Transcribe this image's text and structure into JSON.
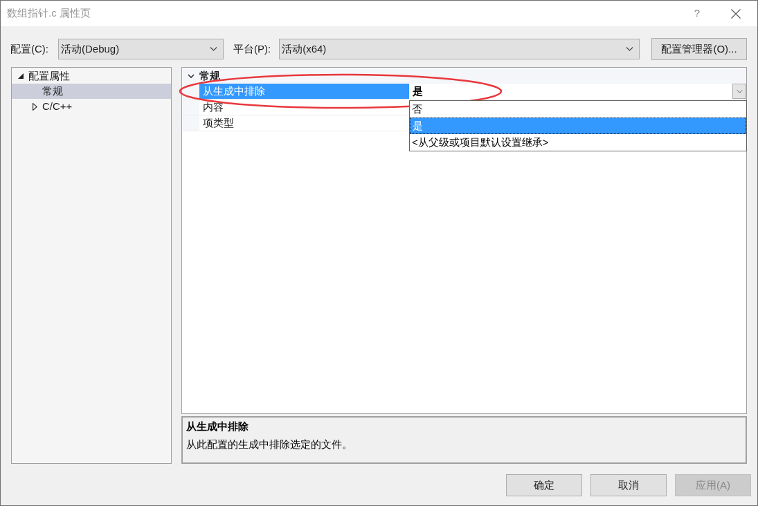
{
  "window": {
    "title": "数组指针.c 属性页",
    "help": "?"
  },
  "toolbar": {
    "configuration": {
      "label": "配置(C):",
      "value": "活动(Debug)"
    },
    "platform": {
      "label": "平台(P):",
      "value": "活动(x64)"
    },
    "manager_button": "配置管理器(O)..."
  },
  "tree": [
    {
      "label": "配置属性",
      "kind": "group",
      "expanded": true,
      "selected": false,
      "children": [
        {
          "label": "常规",
          "kind": "page",
          "selected": true
        },
        {
          "label": "C/C++",
          "kind": "group",
          "expanded": false,
          "selected": false
        }
      ]
    }
  ],
  "property_grid": {
    "categories": [
      {
        "label": "常规",
        "expanded": true,
        "properties": [
          {
            "name": "从生成中排除",
            "value": "是",
            "modified": true,
            "selected": true,
            "dropdown": {
              "open": true,
              "options": [
                {
                  "label": "否",
                  "selected": false
                },
                {
                  "label": "是",
                  "selected": true
                },
                {
                  "label": "<从父级或项目默认设置继承>",
                  "selected": false
                }
              ]
            }
          },
          {
            "name": "内容",
            "selected": false
          },
          {
            "name": "项类型",
            "selected": false
          }
        ]
      }
    ]
  },
  "description": {
    "title": "从生成中排除",
    "text": "从此配置的生成中排除选定的文件。"
  },
  "buttons": [
    {
      "label": "确定",
      "disabled": false
    },
    {
      "label": "取消",
      "disabled": false
    },
    {
      "label": "应用(A)",
      "disabled": true
    }
  ]
}
